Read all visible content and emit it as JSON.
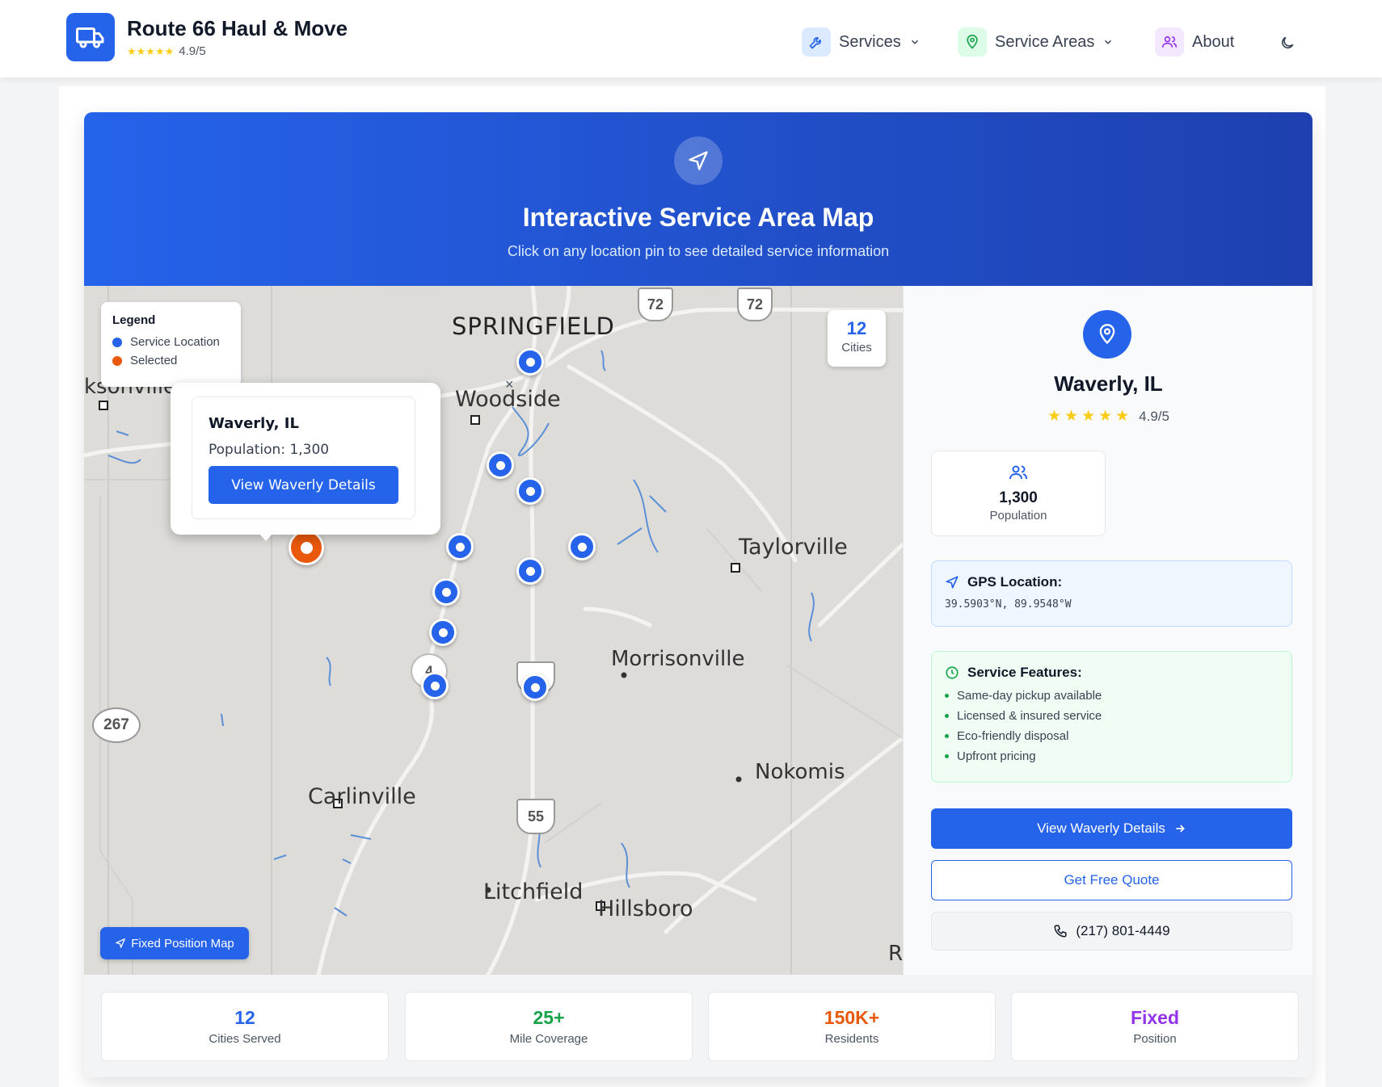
{
  "header": {
    "brand_title": "Route 66 Haul & Move",
    "brand_stars": "★★★★★",
    "brand_rating": "4.9/5",
    "nav": [
      {
        "label": "Services",
        "icon": "wrench-icon",
        "color": "#dbeafe"
      },
      {
        "label": "Service Areas",
        "icon": "map-pin-icon",
        "color": "#dcfce7"
      },
      {
        "label": "About",
        "icon": "users-icon",
        "color": "#f3e8ff"
      }
    ],
    "theme_icon": "moon-icon"
  },
  "banner": {
    "icon": "navigation-icon",
    "title": "Interactive Service Area Map",
    "subtitle": "Click on any location pin to see detailed service information"
  },
  "map": {
    "labels": {
      "springfield": "SPRINGFIELD",
      "woodside": "Woodside",
      "jacksonville": "ksonville",
      "taylorville": "Taylorville",
      "morrisonville": "Morrisonville",
      "nokomis": "Nokomis",
      "carlinville": "Carlinville",
      "litchfield": "Litchfield",
      "hillsboro": "Hillsboro",
      "r_edge": "R"
    },
    "shields": {
      "rt72a": "72",
      "rt72b": "72",
      "rt267": "267",
      "rt4": "4",
      "i55": "55"
    },
    "legend": {
      "title": "Legend",
      "service_location": "Service Location",
      "selected": "Selected",
      "service_color": "#2563eb",
      "selected_color": "#ea580c"
    },
    "cities_badge": {
      "count": "12",
      "label": "Cities"
    },
    "popup": {
      "title": "Waverly, IL",
      "population": "Population: 1,300",
      "button": "View Waverly Details"
    },
    "fixed_button": "Fixed Position Map"
  },
  "side_panel": {
    "title": "Waverly, IL",
    "stars": "★★★★★",
    "rating": "4.9/5",
    "population_value": "1,300",
    "population_label": "Population",
    "gps_title": "GPS Location:",
    "gps_value": "39.5903°N, 89.9548°W",
    "features_title": "Service Features:",
    "features": [
      "Same-day pickup available",
      "Licensed & insured service",
      "Eco-friendly disposal",
      "Upfront pricing"
    ],
    "view_button": "View Waverly Details",
    "quote_button": "Get Free Quote",
    "phone": "(217) 801-4449"
  },
  "stats": [
    {
      "value": "12",
      "label": "Cities Served",
      "color": "#2563eb"
    },
    {
      "value": "25+",
      "label": "Mile Coverage",
      "color": "#16a34a"
    },
    {
      "value": "150K+",
      "label": "Residents",
      "color": "#ea580c"
    },
    {
      "value": "Fixed",
      "label": "Position",
      "color": "#9333ea"
    }
  ]
}
